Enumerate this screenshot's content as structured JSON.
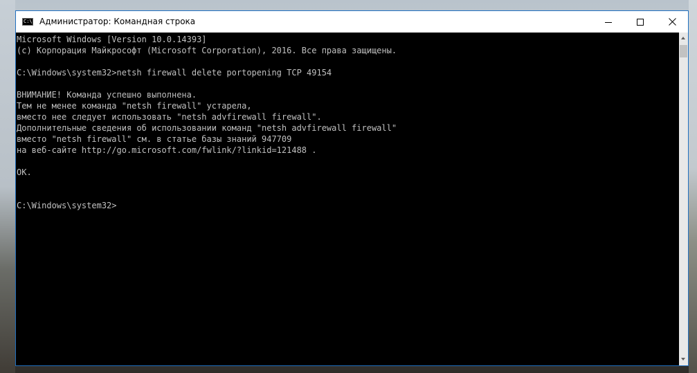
{
  "window": {
    "title": "Администратор: Командная строка",
    "icon_label": "C:\\",
    "icon": "cmd-icon",
    "controls": {
      "minimize_icon": "minimize-icon",
      "maximize_icon": "maximize-icon",
      "close_icon": "close-icon"
    },
    "accent_color": "#1f6fbf"
  },
  "console": {
    "background": "#000000",
    "text_color": "#c0c0c0",
    "lines": [
      "Microsoft Windows [Version 10.0.14393]",
      "(c) Корпорация Майкрософт (Microsoft Corporation), 2016. Все права защищены.",
      "",
      "C:\\Windows\\system32>netsh firewall delete portopening TCP 49154",
      "",
      "ВНИМАНИЕ! Команда успешно выполнена.",
      "Тем не менее команда \"netsh firewall\" устарела,",
      "вместо нее следует использовать \"netsh advfirewall firewall\".",
      "Дополнительные сведения об использовании команд \"netsh advfirewall firewall\"",
      "вместо \"netsh firewall\" см. в статье базы знаний 947709",
      "на веб-сайте http://go.microsoft.com/fwlink/?linkid=121488 .",
      "",
      "OK.",
      "",
      "",
      "C:\\Windows\\system32>"
    ]
  }
}
